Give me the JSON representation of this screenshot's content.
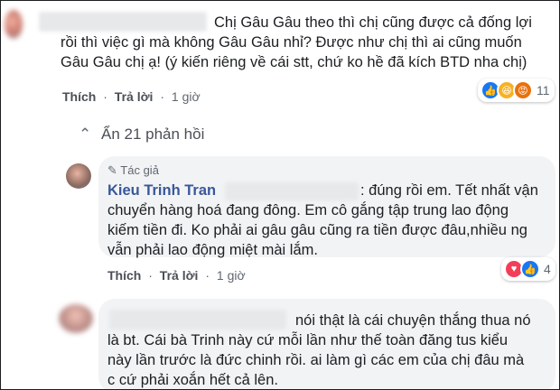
{
  "comment1": {
    "text_lines": [
      "Chị Gâu Gâu theo thì chị cũng được cả đống lợi",
      "rồi thì việc gì mà không Gâu Gâu nhỉ? Được như chị thì ai cũng muốn",
      "Gâu Gâu chị ạ! (ý kiến riêng về cái stt, chứ ko hề đã kích BTD nha chị)"
    ],
    "like_label": "Thích",
    "reply_label": "Trả lời",
    "time": "1 giờ",
    "reaction_count": "11",
    "reactions": [
      "like-icon",
      "haha-icon",
      "angry-icon"
    ]
  },
  "replies_toggle": "Ẩn 21 phản hồi",
  "reply1": {
    "author_badge": "Tác giả",
    "author_name": "Kieu Trinh Tran",
    "text_lines": [
      ": đúng rồi em. Tết nhất vận",
      "chuyển hàng hoá đang đông. Em cô gắng tập trung lao động",
      "kiếm tiền đi. Ko phải ai gâu gâu cũng ra tiền được đâu,nhiều ng",
      "vẫn phải lao động miệt mài lắm."
    ],
    "like_label": "Thích",
    "reply_label": "Trả lời",
    "time": "1 giờ",
    "reaction_count": "4",
    "reactions": [
      "love-icon",
      "like-icon"
    ]
  },
  "reply2": {
    "text_lines": [
      "nói thật là cái chuyện thắng thua nó",
      "là bt. Cái bà Trinh này cứ mỗi lần như thế toàn đăng tus kiểu",
      "này lần trước là đức chinh rồi. ai làm gì các em của chị đâu mà",
      "c cứ phải xoắn hết cả lên."
    ]
  }
}
